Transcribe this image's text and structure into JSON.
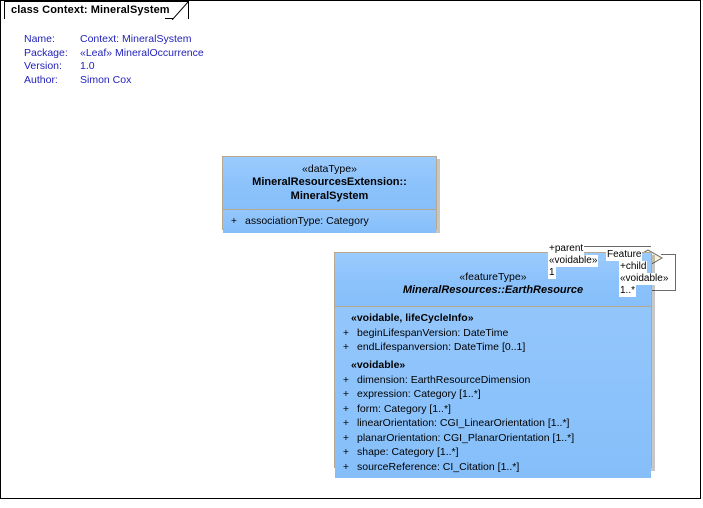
{
  "diagram": {
    "tab_title": "class Context: MineralSystem",
    "metadata": [
      {
        "key": "Name:",
        "value": "Context: MineralSystem"
      },
      {
        "key": "Package:",
        "value": "«Leaf» MineralOccurrence"
      },
      {
        "key": "Version:",
        "value": "1.0"
      },
      {
        "key": "Author:",
        "value": "Simon Cox"
      }
    ]
  },
  "classes": {
    "mineral_system": {
      "stereotype": "«dataType»",
      "name_line1": "MineralResourcesExtension::",
      "name_line2": "MineralSystem",
      "attributes": [
        {
          "visibility": "+",
          "text": "associationType: Category"
        }
      ]
    },
    "earth_resource": {
      "stereotype": "«featureType»",
      "name": "MineralResources::EarthResource",
      "groups": [
        {
          "label": "«voidable, lifeCycleInfo»",
          "attributes": [
            {
              "visibility": "+",
              "text": "beginLifespanVersion: DateTime"
            },
            {
              "visibility": "+",
              "text": "endLifespanversion: DateTime [0..1]"
            }
          ]
        },
        {
          "label": "«voidable»",
          "attributes": [
            {
              "visibility": "+",
              "text": "dimension: EarthResourceDimension"
            },
            {
              "visibility": "+",
              "text": "expression: Category [1..*]"
            },
            {
              "visibility": "+",
              "text": "form: Category [1..*]"
            },
            {
              "visibility": "+",
              "text": "linearOrientation: CGI_LinearOrientation [1..*]"
            },
            {
              "visibility": "+",
              "text": "planarOrientation: CGI_PlanarOrientation [1..*]"
            },
            {
              "visibility": "+",
              "text": "shape: Category [1..*]"
            },
            {
              "visibility": "+",
              "text": "sourceReference: CI_Citation [1..*]"
            }
          ]
        }
      ]
    }
  },
  "association": {
    "name": "Feature",
    "parent_end": {
      "role": "+parent",
      "stereotype": "«voidable»",
      "multiplicity": "1"
    },
    "child_end": {
      "role": "+child",
      "stereotype": "«voidable»",
      "multiplicity": "1..*"
    }
  },
  "colors": {
    "class_fill": "#8fc4fb",
    "class_border": "#b9a98c",
    "metadata_text": "#2222bb",
    "frame_border": "#000000"
  }
}
